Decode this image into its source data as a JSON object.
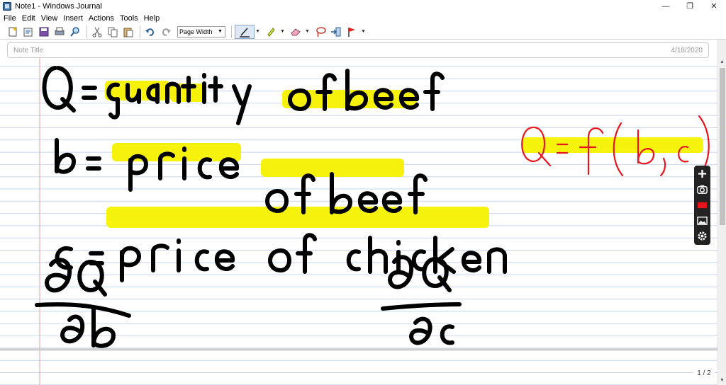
{
  "window": {
    "title": "Note1 - Windows Journal",
    "minimize_glyph": "—",
    "restore_glyph": "❐",
    "close_glyph": "✕"
  },
  "menu": [
    "File",
    "Edit",
    "View",
    "Insert",
    "Actions",
    "Tools",
    "Help"
  ],
  "toolbar": {
    "zoom_value": "Page Width",
    "icons": [
      "new-note-icon",
      "open-icon",
      "save-icon",
      "print-icon",
      "find-icon",
      "cut-icon",
      "copy-icon",
      "paste-icon",
      "undo-icon",
      "redo-icon",
      "pen-icon",
      "highlighter-icon",
      "eraser-icon",
      "lasso-select-icon",
      "insert-space-icon",
      "flag-icon"
    ]
  },
  "note": {
    "title_placeholder": "Note Title",
    "date": "4/18/2020",
    "page_indicator": "1 / 2"
  },
  "handwriting": [
    {
      "line": "Q = quantity of beef",
      "highlighted": "quantity of beef"
    },
    {
      "line": "b = price of beef",
      "highlighted": "price of beef"
    },
    {
      "line": "c = price of chicken",
      "highlighted": "price of chicken"
    },
    {
      "line": "∂Q / ∂b"
    },
    {
      "line": "∂Q / ∂c"
    },
    {
      "line": "Q = f(b, c)",
      "color": "red",
      "highlighted": "Q = f(b, c)"
    }
  ],
  "recorder_panel": {
    "icons": [
      "add-icon",
      "camera-icon",
      "record-icon",
      "image-icon",
      "settings-icon"
    ]
  },
  "colors": {
    "ruled_line": "#c9d8f0",
    "margin_line": "#e9a0a0",
    "highlighter": "#f6f200",
    "ink_black": "#000000",
    "ink_red": "#e8141c"
  }
}
